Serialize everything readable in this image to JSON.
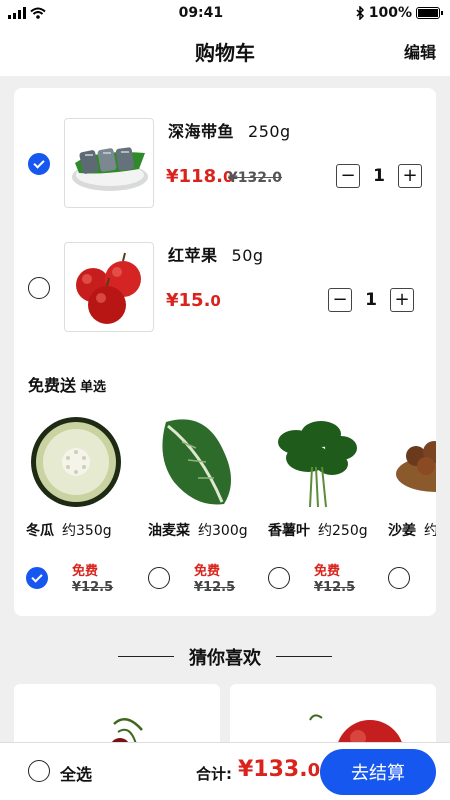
{
  "status_bar": {
    "time": "09:41",
    "battery": "100%",
    "battery_level": 1.0
  },
  "header": {
    "title": "购物车",
    "edit_label": "编辑"
  },
  "cart": {
    "items": [
      {
        "name": "深海带鱼",
        "weight": "250g",
        "price_int": "¥118.",
        "price_dec": "0",
        "old_price": "¥132.0",
        "quantity": "1",
        "selected": true
      },
      {
        "name": "红苹果",
        "weight": "50g",
        "price_int": "¥15.",
        "price_dec": "0",
        "quantity": "1",
        "selected": false
      }
    ],
    "gift_section": {
      "title": "免费送",
      "mode": "单选",
      "gifts": [
        {
          "name": "冬瓜",
          "weight": "约350g",
          "free": "免费",
          "old_price": "¥12.5",
          "selected": true
        },
        {
          "name": "油麦菜",
          "weight": "约300g",
          "free": "免费",
          "old_price": "¥12.5",
          "selected": false
        },
        {
          "name": "香薯叶",
          "weight": "约250g",
          "free": "免费",
          "old_price": "¥12.5",
          "selected": false
        },
        {
          "name": "沙姜",
          "weight": "约",
          "free": "",
          "old_price": "",
          "selected": false
        }
      ]
    }
  },
  "recommend": {
    "title": "猜你喜欢"
  },
  "footer": {
    "select_all": "全选",
    "total_label": "合计:",
    "total_int": "¥133.",
    "total_dec": "0",
    "checkout_label": "去结算"
  },
  "colors": {
    "accent": "#1657f0",
    "price": "#d9231c",
    "background": "#efefef"
  }
}
